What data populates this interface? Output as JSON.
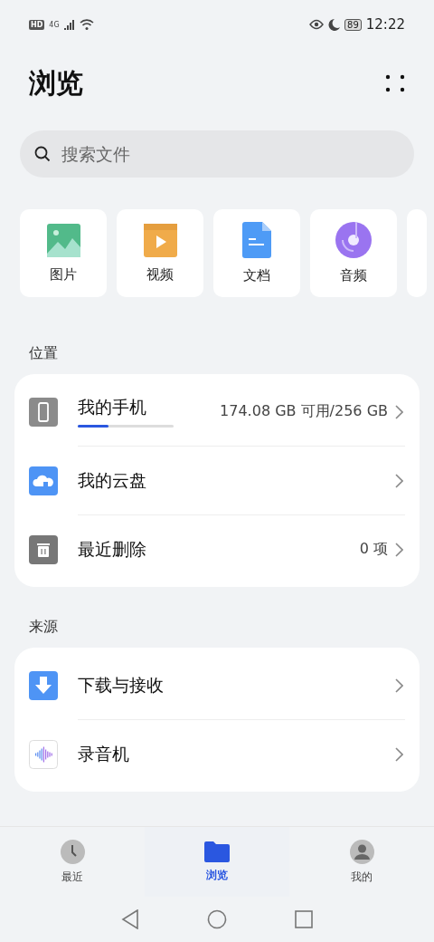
{
  "status_bar": {
    "hd": "HD",
    "network": "4G",
    "battery": "89",
    "time": "12:22"
  },
  "title": "浏览",
  "search": {
    "placeholder": "搜索文件"
  },
  "categories": [
    {
      "kind": "image",
      "label": "图片"
    },
    {
      "kind": "video",
      "label": "视频"
    },
    {
      "kind": "document",
      "label": "文档"
    },
    {
      "kind": "audio",
      "label": "音频"
    },
    {
      "kind": "partial"
    }
  ],
  "sections": [
    {
      "title": "位置",
      "items": [
        {
          "kind": "phone",
          "label": "我的手机",
          "level": 0.32,
          "detail": "174.08 GB 可用/256 GB"
        },
        {
          "kind": "cloud",
          "label": "我的云盘"
        },
        {
          "kind": "trash",
          "label": "最近删除",
          "detail": "0 项"
        }
      ]
    },
    {
      "title": "来源",
      "items": [
        {
          "kind": "download",
          "label": "下载与接收"
        },
        {
          "kind": "recorder",
          "label": "录音机"
        }
      ]
    }
  ],
  "tabs": [
    {
      "kind": "recent",
      "label": "最近",
      "selected": false
    },
    {
      "kind": "browse",
      "label": "浏览",
      "selected": true
    },
    {
      "kind": "me",
      "label": "我的",
      "selected": false
    }
  ]
}
